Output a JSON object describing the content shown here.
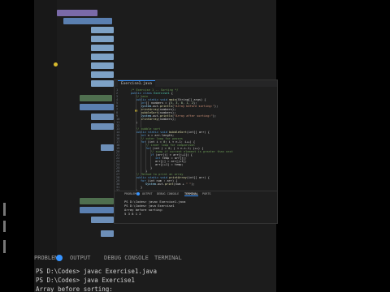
{
  "editor": {
    "file_tab": "Exercise1.java",
    "line_numbers": [
      "1",
      "2",
      "3",
      "4",
      "5",
      "6",
      "7",
      "8",
      "9",
      "10",
      "11",
      "12",
      "13",
      "14",
      "15",
      "16",
      "17",
      "18",
      "19",
      "20",
      "21",
      "22",
      "23",
      "24",
      "25",
      "26",
      "27",
      "28",
      "29",
      "30",
      "31",
      "32"
    ],
    "code_lines": [
      {
        "i": 0,
        "parts": [
          {
            "c": "cm",
            "t": "/* Exercise 1 -- Sorting */"
          }
        ]
      },
      {
        "i": 0,
        "parts": [
          {
            "c": "kw",
            "t": "public class "
          },
          {
            "c": "ty",
            "t": "Exercise1"
          },
          {
            "c": "",
            "t": " {"
          }
        ]
      },
      {
        "i": 1,
        "parts": [
          {
            "c": "cm",
            "t": "// main"
          }
        ]
      },
      {
        "i": 1,
        "parts": [
          {
            "c": "kw",
            "t": "public static void "
          },
          {
            "c": "fn",
            "t": "main"
          },
          {
            "c": "",
            "t": "(String[] args) {"
          }
        ]
      },
      {
        "i": 2,
        "parts": [
          {
            "c": "kw",
            "t": "int"
          },
          {
            "c": "",
            "t": "[] numbers = {"
          },
          {
            "c": "nm",
            "t": "5, 3, 8, 1, 2"
          },
          {
            "c": "",
            "t": "};"
          }
        ]
      },
      {
        "i": 2,
        "parts": [
          {
            "c": "va",
            "t": "System"
          },
          {
            "c": "",
            "t": ".out."
          },
          {
            "c": "fn",
            "t": "println"
          },
          {
            "c": "",
            "t": "("
          },
          {
            "c": "st",
            "t": "\"Array before sorting:\""
          },
          {
            "c": "",
            "t": ");"
          }
        ]
      },
      {
        "i": 2,
        "parts": [
          {
            "c": "fn",
            "t": "printArray"
          },
          {
            "c": "",
            "t": "(numbers);"
          }
        ]
      },
      {
        "i": 2,
        "parts": [
          {
            "c": "fn",
            "t": "bubbleSort"
          },
          {
            "c": "",
            "t": "(numbers);"
          }
        ]
      },
      {
        "i": 2,
        "parts": [
          {
            "c": "va",
            "t": "System"
          },
          {
            "c": "",
            "t": ".out."
          },
          {
            "c": "fn",
            "t": "println"
          },
          {
            "c": "",
            "t": "("
          },
          {
            "c": "st",
            "t": "\"Array after sorting:\""
          },
          {
            "c": "",
            "t": ");"
          }
        ]
      },
      {
        "i": 2,
        "parts": [
          {
            "c": "fn",
            "t": "printArray"
          },
          {
            "c": "",
            "t": "(numbers);"
          }
        ]
      },
      {
        "i": 1,
        "parts": [
          {
            "c": "",
            "t": "}"
          }
        ]
      },
      {
        "i": 0,
        "parts": [
          {
            "c": "",
            "t": ""
          }
        ]
      },
      {
        "i": 1,
        "parts": [
          {
            "c": "cm",
            "t": "// bubble sort"
          }
        ]
      },
      {
        "i": 1,
        "parts": [
          {
            "c": "kw",
            "t": "public static void "
          },
          {
            "c": "fn",
            "t": "bubbleSort"
          },
          {
            "c": "",
            "t": "(int[] arr) {"
          }
        ]
      },
      {
        "i": 2,
        "parts": [
          {
            "c": "kw",
            "t": "int"
          },
          {
            "c": "",
            "t": " n = arr.length;"
          }
        ]
      },
      {
        "i": 2,
        "parts": [
          {
            "c": "cm",
            "t": "// outer loop for passes"
          }
        ]
      },
      {
        "i": 2,
        "parts": [
          {
            "c": "kw",
            "t": "for"
          },
          {
            "c": "",
            "t": " (int i = "
          },
          {
            "c": "nm",
            "t": "0"
          },
          {
            "c": "",
            "t": "; i < n-1; i++) {"
          }
        ]
      },
      {
        "i": 3,
        "parts": [
          {
            "c": "cm",
            "t": "// inner loop for comparison"
          }
        ]
      },
      {
        "i": 3,
        "parts": [
          {
            "c": "kw",
            "t": "for"
          },
          {
            "c": "",
            "t": " (int j = "
          },
          {
            "c": "nm",
            "t": "0"
          },
          {
            "c": "",
            "t": "; j < n-i-1; j++) {"
          }
        ]
      },
      {
        "i": 4,
        "parts": [
          {
            "c": "cm",
            "t": "// swap if current element is greater than next"
          }
        ]
      },
      {
        "i": 4,
        "parts": [
          {
            "c": "kw",
            "t": "if"
          },
          {
            "c": "",
            "t": " (arr[j] > arr[j+1]) {"
          }
        ]
      },
      {
        "i": 5,
        "parts": [
          {
            "c": "kw",
            "t": "int"
          },
          {
            "c": "",
            "t": " temp = arr[j];"
          }
        ]
      },
      {
        "i": 5,
        "parts": [
          {
            "c": "",
            "t": "arr[j] = arr[j+1];"
          }
        ]
      },
      {
        "i": 5,
        "parts": [
          {
            "c": "",
            "t": "arr[j+1] = temp;"
          }
        ]
      },
      {
        "i": 4,
        "parts": [
          {
            "c": "",
            "t": "}"
          }
        ]
      },
      {
        "i": 3,
        "parts": [
          {
            "c": "",
            "t": "}"
          }
        ]
      },
      {
        "i": 1,
        "parts": [
          {
            "c": "cm",
            "t": "// Method to print an array"
          }
        ]
      },
      {
        "i": 1,
        "parts": [
          {
            "c": "kw",
            "t": "public static void "
          },
          {
            "c": "fn",
            "t": "printArray"
          },
          {
            "c": "",
            "t": "(int[] arr) {"
          }
        ]
      },
      {
        "i": 2,
        "parts": [
          {
            "c": "kw",
            "t": "for"
          },
          {
            "c": "",
            "t": " (int num : arr) {"
          }
        ]
      },
      {
        "i": 3,
        "parts": [
          {
            "c": "va",
            "t": "System"
          },
          {
            "c": "",
            "t": ".out."
          },
          {
            "c": "fn",
            "t": "print"
          },
          {
            "c": "",
            "t": "(num + "
          },
          {
            "c": "st",
            "t": "\" \""
          },
          {
            "c": "",
            "t": ");"
          }
        ]
      },
      {
        "i": 2,
        "parts": [
          {
            "c": "",
            "t": "}"
          }
        ]
      },
      {
        "i": 1,
        "parts": [
          {
            "c": "",
            "t": "}"
          }
        ]
      }
    ]
  },
  "panel": {
    "tabs": [
      "PROBLEMS",
      "OUTPUT",
      "DEBUG CONSOLE",
      "TERMINAL",
      "PORTS"
    ],
    "active_tab": "TERMINAL",
    "terminal_lines": [
      "PS D:\\Codes> javac Exercise1.java",
      "PS D:\\Codes> java Exercise1",
      "Array before sorting:",
      "5 3 8 1 2"
    ]
  },
  "background": {
    "tabs": [
      "PROBLEMS",
      "OUTPUT",
      "DEBUG CONSOLE",
      "TERMINAL"
    ],
    "terminal_lines": [
      "PS D:\\Codes> javac Exercise1.java",
      "PS D:\\Codes> java Exercise1",
      "Array before sorting:"
    ]
  },
  "colors": {
    "accent": "#3794ff",
    "background": "#1e1e1e",
    "keyword": "#569cd6",
    "function": "#dcdcaa",
    "string": "#ce9178",
    "comment": "#6a9955"
  }
}
